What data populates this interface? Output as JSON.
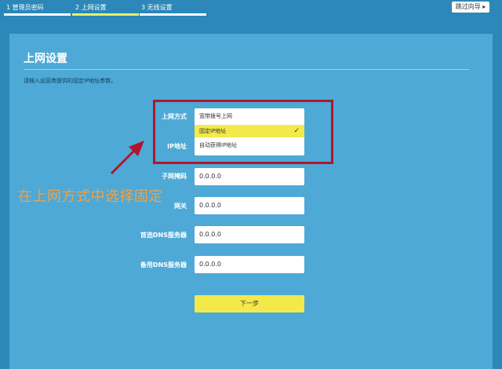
{
  "wizard": {
    "steps": [
      {
        "label": "1 管理员密码"
      },
      {
        "label": "2 上网设置"
      },
      {
        "label": "3 无线设置"
      }
    ],
    "skip_label": "跳过向导 ▸"
  },
  "page": {
    "title": "上网设置",
    "hint": "请输入运营商提供的固定IP地址参数。"
  },
  "form": {
    "connection_type": {
      "label": "上网方式",
      "options": [
        {
          "label": "宽带拨号上网"
        },
        {
          "label": "固定IP地址"
        },
        {
          "label": "自动获得IP地址"
        }
      ]
    },
    "ip": {
      "label": "IP地址"
    },
    "subnet": {
      "label": "子网掩码",
      "value": "0.0.0.0"
    },
    "gateway": {
      "label": "网关",
      "value": "0.0.0.0"
    },
    "dns_primary": {
      "label": "首选DNS服务器",
      "value": "0.0.0.0"
    },
    "dns_secondary": {
      "label": "备用DNS服务器",
      "value": "0.0.0.0"
    },
    "next_label": "下一步"
  },
  "annotation": {
    "text": "在上网方式中选择固定",
    "color": "#b0162a"
  },
  "colors": {
    "background": "#2b88b8",
    "panel": "#4ea9d6",
    "accent": "#f4e94a"
  }
}
